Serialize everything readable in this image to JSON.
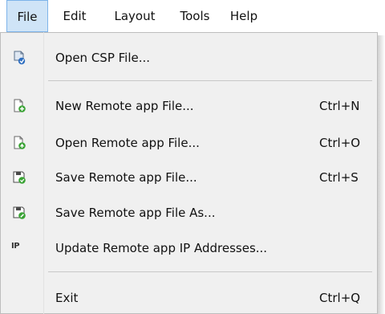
{
  "menubar": {
    "items": [
      {
        "label": "File"
      },
      {
        "label": "Edit"
      },
      {
        "label": "Layout"
      },
      {
        "label": "Tools"
      },
      {
        "label": "Help"
      }
    ]
  },
  "file_menu": {
    "items": [
      {
        "label": "Open CSP File...",
        "shortcut": "",
        "icon": "open-csp-file-icon"
      },
      {
        "label": "New Remote app File...",
        "shortcut": "Ctrl+N",
        "icon": "new-file-icon"
      },
      {
        "label": "Open Remote app File...",
        "shortcut": "Ctrl+O",
        "icon": "open-file-icon"
      },
      {
        "label": "Save Remote app File...",
        "shortcut": "Ctrl+S",
        "icon": "save-file-icon"
      },
      {
        "label": "Save Remote app File As...",
        "shortcut": "",
        "icon": "save-as-file-icon"
      },
      {
        "label": "Update Remote app IP Addresses...",
        "shortcut": "",
        "icon": "ip-icon",
        "icon_text": "IP"
      },
      {
        "label": "Exit",
        "shortcut": "Ctrl+Q",
        "icon": ""
      }
    ]
  },
  "colors": {
    "menu_background": "#f0f0f0",
    "active_menu_highlight": "#cfe4f7",
    "active_menu_border": "#7eb4ea",
    "icon_green": "#3aa335",
    "icon_blue": "#2f6fc0"
  }
}
